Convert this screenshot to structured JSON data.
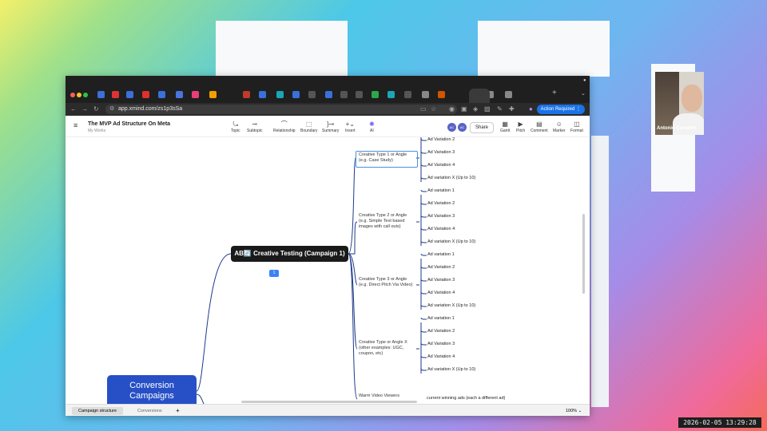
{
  "browser": {
    "url": "app.xmind.com/zs1p3sSa",
    "action_required": "Action Required"
  },
  "app": {
    "title": "The MVP Ad Structure On Meta",
    "subtitle": "My Works",
    "tools": [
      "Topic",
      "Subtopic",
      "Relationship",
      "Boundary",
      "Summary",
      "Insert",
      "AI"
    ],
    "right_tools": [
      "Gantt",
      "Pitch",
      "Comment",
      "Marker",
      "Format"
    ],
    "share_label": "Share",
    "avatars": [
      "AC",
      "AC"
    ]
  },
  "mindmap": {
    "root": "Conversion Campaigns",
    "main_topic": "AB🔄 Creative Testing (Campaign 1)",
    "badge": "1",
    "branches": [
      {
        "label": "Creative Type 1 or Angle (e.g. Case Study)",
        "leaves": [
          "Ad Variation 2",
          "Ad Variation 3",
          "Ad Variation 4",
          "Ad variation X (Up to 10)"
        ]
      },
      {
        "label": "Creative Type 2 or Angle (e.g. Simple Text based images with call outs)",
        "leaves": [
          "Ad variation 1",
          "Ad Variation 2",
          "Ad Variation 3",
          "Ad Variation 4",
          "Ad variation X (Up to 10)"
        ]
      },
      {
        "label": "Creative Type 3 or Angle (e.g. Direct Pitch Via Video)",
        "leaves": [
          "Ad variation 1",
          "Ad Variation 2",
          "Ad Variation 3",
          "Ad Variation 4",
          "Ad variation X (Up to 10)"
        ]
      },
      {
        "label": "Creative Type or Angle X (other examples: UGC, coupon, etc)",
        "leaves": [
          "Ad variation 1",
          "Ad Variation 2",
          "Ad Variation 3",
          "Ad Variation 4",
          "Ad variation X (Up to 10)"
        ]
      }
    ],
    "partial_topic": "Warm Video Viewers",
    "partial_leaf": "current winning ads (each a different ad)"
  },
  "sheets": {
    "tabs": [
      "Campaign structure",
      "Conversions"
    ],
    "add": "+",
    "zoom": "100%"
  },
  "webcam": {
    "name": "Antonio Carneiro"
  },
  "timestamp": "2026-02-05  13:29:28"
}
